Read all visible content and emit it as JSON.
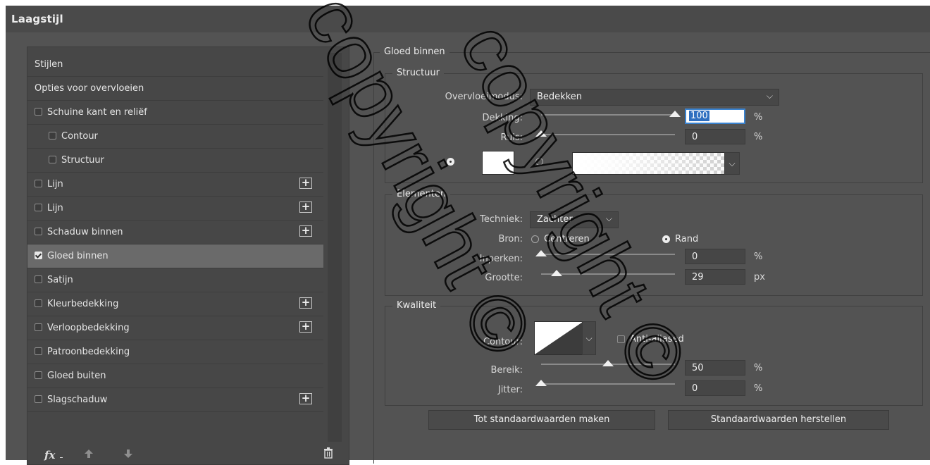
{
  "window": {
    "title": "Laagstijl"
  },
  "styles": {
    "items": [
      {
        "label": "Stijlen",
        "checkbox": false,
        "checked": false,
        "plus": false,
        "selected": false,
        "indent": 0
      },
      {
        "label": "Opties voor overvloeien",
        "checkbox": false,
        "checked": false,
        "plus": false,
        "selected": false,
        "indent": 0
      },
      {
        "label": "Schuine kant en reliëf",
        "checkbox": true,
        "checked": false,
        "plus": false,
        "selected": false,
        "indent": 0
      },
      {
        "label": "Contour",
        "checkbox": true,
        "checked": false,
        "plus": false,
        "selected": false,
        "indent": 1
      },
      {
        "label": "Structuur",
        "checkbox": true,
        "checked": false,
        "plus": false,
        "selected": false,
        "indent": 1
      },
      {
        "label": "Lijn",
        "checkbox": true,
        "checked": false,
        "plus": true,
        "selected": false,
        "indent": 0
      },
      {
        "label": "Lijn",
        "checkbox": true,
        "checked": false,
        "plus": true,
        "selected": false,
        "indent": 0
      },
      {
        "label": "Schaduw binnen",
        "checkbox": true,
        "checked": false,
        "plus": true,
        "selected": false,
        "indent": 0
      },
      {
        "label": "Gloed binnen",
        "checkbox": true,
        "checked": true,
        "plus": false,
        "selected": true,
        "indent": 0
      },
      {
        "label": "Satijn",
        "checkbox": true,
        "checked": false,
        "plus": false,
        "selected": false,
        "indent": 0
      },
      {
        "label": "Kleurbedekking",
        "checkbox": true,
        "checked": false,
        "plus": true,
        "selected": false,
        "indent": 0
      },
      {
        "label": "Verloopbedekking",
        "checkbox": true,
        "checked": false,
        "plus": true,
        "selected": false,
        "indent": 0
      },
      {
        "label": "Patroonbedekking",
        "checkbox": true,
        "checked": false,
        "plus": false,
        "selected": false,
        "indent": 0
      },
      {
        "label": "Gloed buiten",
        "checkbox": true,
        "checked": false,
        "plus": false,
        "selected": false,
        "indent": 0
      },
      {
        "label": "Slagschaduw",
        "checkbox": true,
        "checked": false,
        "plus": true,
        "selected": false,
        "indent": 0
      }
    ],
    "fx_label": "fx",
    "icons": [
      "fx-icon",
      "move-up-icon",
      "move-down-icon",
      "trash-icon"
    ]
  },
  "panel": {
    "section_title": "Gloed binnen",
    "structuur": {
      "legend": "Structuur",
      "blend_label": "Overvloeimodus:",
      "blend_value": "Bedekken",
      "opacity_label": "Dekking:",
      "opacity_value": "100",
      "opacity_level": 100,
      "opacity_unit": "%",
      "noise_label": "Ruis:",
      "noise_value": "0",
      "noise_level": 0,
      "noise_unit": "%",
      "color_mode": "solid",
      "color": "#ffffff"
    },
    "elementen": {
      "legend": "Elementen",
      "technique_label": "Techniek:",
      "technique_value": "Zachter",
      "source_label": "Bron:",
      "source_center": "Centreren",
      "source_edge": "Rand",
      "source_selected": "Rand",
      "choke_label": "Inperken:",
      "choke_value": "0",
      "choke_level": 0,
      "choke_unit": "%",
      "size_label": "Grootte:",
      "size_value": "29",
      "size_max": 250,
      "size_unit": "px"
    },
    "kwaliteit": {
      "legend": "Kwaliteit",
      "contour_label": "Contour:",
      "antialias_label": "Anti-aliased",
      "antialias_checked": false,
      "range_label": "Bereik:",
      "range_value": "50",
      "range_level": 50,
      "range_unit": "%",
      "jitter_label": "Jitter:",
      "jitter_value": "0",
      "jitter_level": 0,
      "jitter_unit": "%"
    },
    "buttons": {
      "make_default": "Tot standaardwaarden maken",
      "reset_default": "Standaardwaarden herstellen"
    }
  },
  "watermark": {
    "text": "copyright ©",
    "color": "#000000"
  }
}
